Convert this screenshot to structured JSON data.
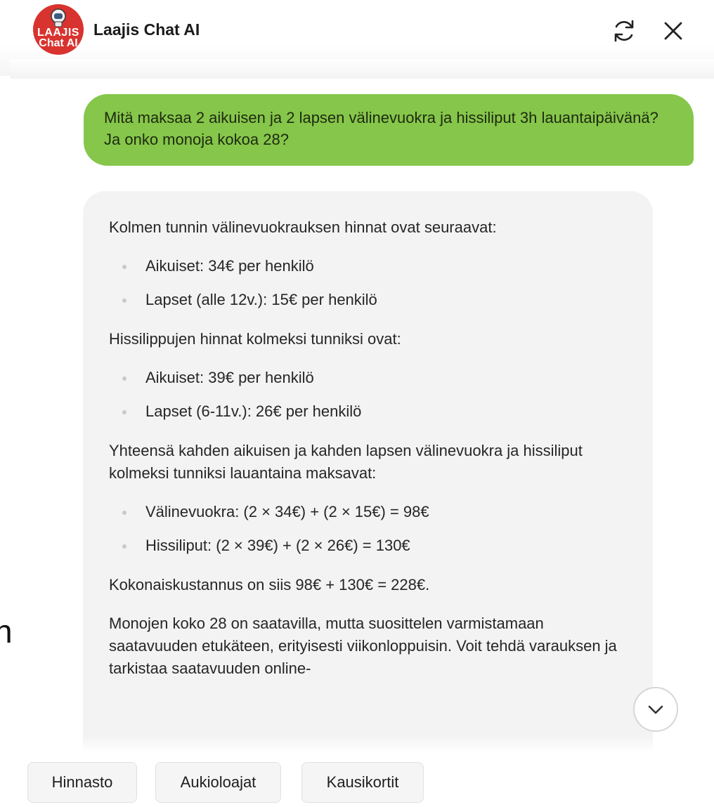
{
  "header": {
    "logo_line1": "LAAJIS",
    "logo_line2": "Chat AI",
    "title": "Laajis Chat AI",
    "refresh_icon": "refresh-icon",
    "close_icon": "close-icon"
  },
  "conversation": {
    "user_message": "Mitä maksaa 2 aikuisen ja 2 lapsen välinevuokra ja hissiliput 3h lauantaipäivänä? Ja onko monoja kokoa 28?",
    "bot_message": {
      "p1": "Kolmen tunnin välinevuokrauksen hinnat ovat seuraavat:",
      "list1": [
        "Aikuiset: 34€ per henkilö",
        "Lapset (alle 12v.): 15€ per henkilö"
      ],
      "p2": "Hissilippujen hinnat kolmeksi tunniksi ovat:",
      "list2": [
        "Aikuiset: 39€ per henkilö",
        "Lapset (6-11v.): 26€ per henkilö"
      ],
      "p3": "Yhteensä kahden aikuisen ja kahden lapsen välinevuokra ja hissiliput kolmeksi tunniksi lauantaina maksavat:",
      "list3": [
        "Välinevuokra: (2 × 34€) + (2 × 15€) = 98€",
        "Hissiliput: (2 × 39€) + (2 × 26€) = 130€"
      ],
      "p4": "Kokonaiskustannus on siis 98€ + 130€ = 228€.",
      "p5": "Monojen koko 28 on saatavilla, mutta suosittelen varmista­maan saatavuuden etukäteen, erityisesti viikonloppuisin. Voit tehdä varauksen ja tarkistaa saatavuuden online-"
    }
  },
  "scroll_button_icon": "chevron-down-icon",
  "quick_replies": [
    "Hinnasto",
    "Aukioloajat",
    "Kausikortit"
  ],
  "colors": {
    "user_bubble": "#86c64a",
    "bot_bubble": "#f3f3f3",
    "logo_bg": "#d8332f"
  }
}
